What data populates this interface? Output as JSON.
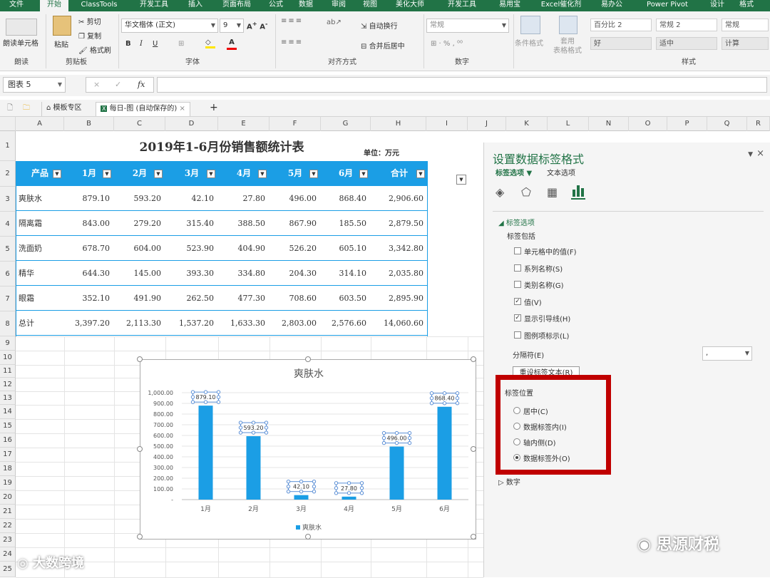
{
  "ribbon_tabs": [
    "文件",
    "开始",
    "ClassTools",
    "开发工具",
    "插入",
    "页面布局",
    "公式",
    "数据",
    "审阅",
    "视图",
    "美化大师",
    "开发工具",
    "易用宝",
    "Excel催化剂",
    "易办公",
    "Power Pivot",
    "设计",
    "格式"
  ],
  "ribbon": {
    "groups": {
      "undo": "朗读",
      "clipboard": "剪贴板",
      "font": "字体",
      "align": "对齐方式",
      "number": "数字",
      "styles": "样式"
    },
    "undo_cell_label": "朗读单元格",
    "paste": "粘贴",
    "cut": "剪切",
    "copy": "复制",
    "format_painter": "格式刷",
    "font_name": "华文楷体 (正文)",
    "font_size": "9",
    "wrap": "自动换行",
    "merge": "合并后居中",
    "number_format": "常规",
    "cond_format": "条件格式",
    "table_format": "套用\n表格格式",
    "styles": [
      "百分比 2",
      "常规 2",
      "常规",
      "好",
      "适中",
      "计算"
    ]
  },
  "formula_bar": {
    "name_box": "图表 5",
    "fx": "fx",
    "cancel": "×",
    "confirm": "✓"
  },
  "workbook_tabs": {
    "template": "模板专区",
    "file": "每日-图 (自动保存的)"
  },
  "columns": [
    "A",
    "B",
    "C",
    "D",
    "E",
    "F",
    "G",
    "H",
    "I",
    "J",
    "K",
    "L",
    "N",
    "O",
    "P",
    "Q",
    "R"
  ],
  "rows": [
    "1",
    "2",
    "3",
    "4",
    "5",
    "6",
    "7",
    "8",
    "9",
    "10",
    "11",
    "12",
    "13",
    "14",
    "15",
    "16",
    "17",
    "18",
    "19",
    "20",
    "21",
    "22",
    "23",
    "24",
    "25"
  ],
  "sheet": {
    "title": "2019年1-6月份销售额统计表",
    "unit": "单位：万元",
    "headers": [
      "产品",
      "1月",
      "2月",
      "3月",
      "4月",
      "5月",
      "6月",
      "合计"
    ],
    "rows": [
      [
        "爽肤水",
        "879.10",
        "593.20",
        "42.10",
        "27.80",
        "496.00",
        "868.40",
        "2,906.60"
      ],
      [
        "隔离霜",
        "843.00",
        "279.20",
        "315.40",
        "388.50",
        "867.90",
        "185.50",
        "2,879.50"
      ],
      [
        "洗面奶",
        "678.70",
        "604.00",
        "523.90",
        "404.90",
        "526.20",
        "605.10",
        "3,342.80"
      ],
      [
        "精华",
        "644.30",
        "145.00",
        "393.30",
        "334.80",
        "204.30",
        "314.10",
        "2,035.80"
      ],
      [
        "眼霜",
        "352.10",
        "491.90",
        "262.50",
        "477.30",
        "708.60",
        "603.50",
        "2,895.90"
      ],
      [
        "总计",
        "3,397.20",
        "2,113.30",
        "1,537.20",
        "1,633.30",
        "2,803.00",
        "2,576.60",
        "14,060.60"
      ]
    ]
  },
  "chart_data": {
    "type": "bar",
    "title": "爽肤水",
    "categories": [
      "1月",
      "2月",
      "3月",
      "4月",
      "5月",
      "6月"
    ],
    "series": [
      {
        "name": "爽肤水",
        "values": [
          879.1,
          593.2,
          42.1,
          27.8,
          496.0,
          868.4
        ]
      }
    ],
    "data_labels": [
      "879.10",
      "593.20",
      "42.10",
      "27.80",
      "496.00",
      "868.40"
    ],
    "yticks": [
      "1,000.00",
      "900.00",
      "800.00",
      "700.00",
      "600.00",
      "500.00",
      "400.00",
      "300.00",
      "200.00",
      "100.00",
      "-"
    ],
    "ylim": [
      0,
      1000
    ],
    "color": "#1b9ee5",
    "legend": "bottom"
  },
  "panel": {
    "title": "设置数据标签格式",
    "tab_label_options": "标签选项",
    "tab_text_options": "文本选项",
    "section": "标签选项",
    "includes": "标签包括",
    "checks": [
      {
        "label": "单元格中的值(F)",
        "checked": false
      },
      {
        "label": "系列名称(S)",
        "checked": false
      },
      {
        "label": "类别名称(G)",
        "checked": false
      },
      {
        "label": "值(V)",
        "checked": true
      },
      {
        "label": "显示引导线(H)",
        "checked": true
      },
      {
        "label": "图例项标示(L)",
        "checked": false
      }
    ],
    "separator_label": "分隔符(E)",
    "separator_value": ",",
    "reset_button": "重设标签文本(R)",
    "position_title": "标签位置",
    "positions": [
      {
        "label": "居中(C)",
        "selected": false
      },
      {
        "label": "数据标签内(I)",
        "selected": false
      },
      {
        "label": "轴内侧(D)",
        "selected": false
      },
      {
        "label": "数据标签外(O)",
        "selected": true
      }
    ],
    "number_section": "数字"
  },
  "watermarks": {
    "left": "大数跨境",
    "right": "思源财税"
  }
}
